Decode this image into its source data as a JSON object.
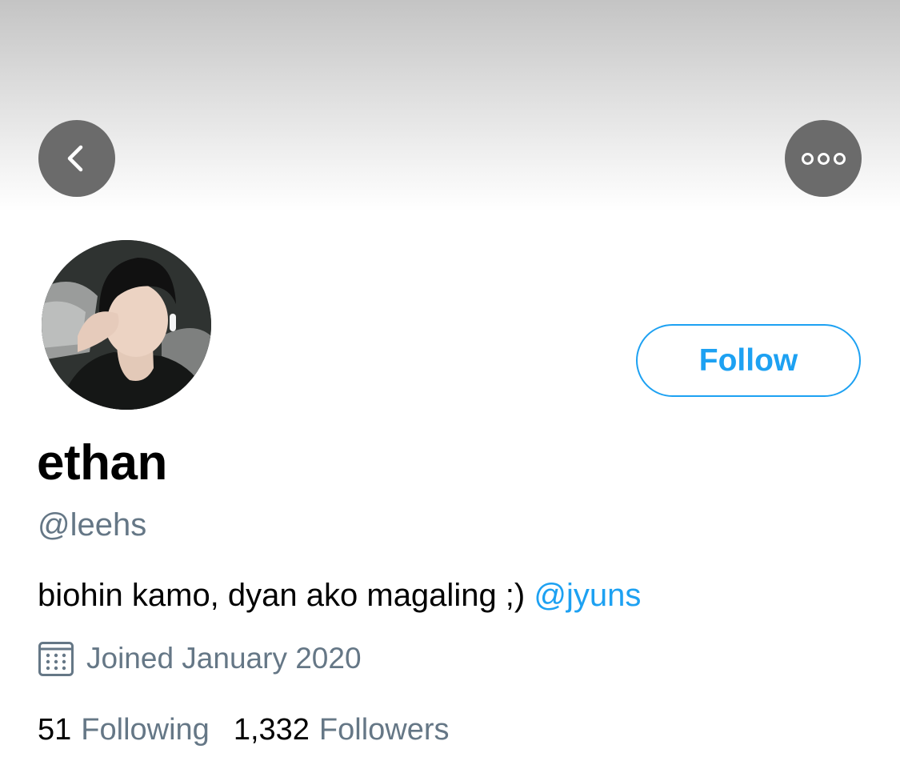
{
  "header": {
    "back_icon": "chevron-left-icon",
    "more_icon": "more-horizontal-icon"
  },
  "profile": {
    "display_name": "ethan",
    "handle": "@leehs",
    "bio_text": "biohin kamo, dyan ako magaling ;) ",
    "bio_mention": "@jyuns",
    "joined": "Joined January 2020",
    "joined_icon": "calendar-icon",
    "follow_label": "Follow",
    "following_count": "51",
    "following_label": "Following",
    "followers_count": "1,332",
    "followers_label": "Followers"
  },
  "colors": {
    "accent": "#1da1f2",
    "secondary_text": "#657786",
    "primary_text": "#000000",
    "nav_button_bg": "#6b6b6b"
  }
}
